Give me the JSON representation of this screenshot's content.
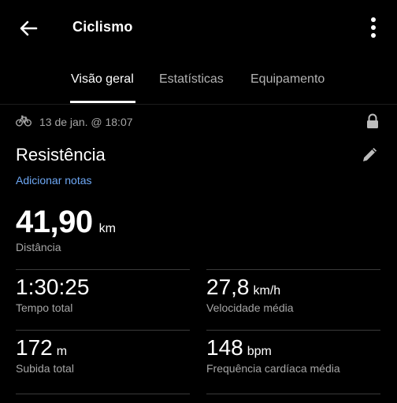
{
  "header": {
    "title": "Ciclismo"
  },
  "tabs": [
    {
      "label": "Visão geral"
    },
    {
      "label": "Estatísticas"
    },
    {
      "label": "Equipamento"
    }
  ],
  "activity": {
    "datetime": "13 de jan. @ 18:07",
    "name": "Resistência",
    "add_notes": "Adicionar notas"
  },
  "distance": {
    "value": "41,90",
    "unit": "km",
    "label": "Distância"
  },
  "stats": [
    {
      "value": "1:30:25",
      "unit": "",
      "label": "Tempo total"
    },
    {
      "value": "27,8",
      "unit": "km/h",
      "label": "Velocidade média"
    },
    {
      "value": "172",
      "unit": "m",
      "label": "Subida total"
    },
    {
      "value": "148",
      "unit": "bpm",
      "label": "Frequência cardíaca média"
    }
  ],
  "icons": {
    "back": "arrow-left-icon",
    "more": "more-vertical-icon",
    "activity_type": "bicycle-icon",
    "privacy": "lock-icon",
    "edit": "pencil-icon"
  },
  "colors": {
    "background": "#000000",
    "link": "#6ea8f5",
    "secondary_text": "#a6a6a6"
  }
}
